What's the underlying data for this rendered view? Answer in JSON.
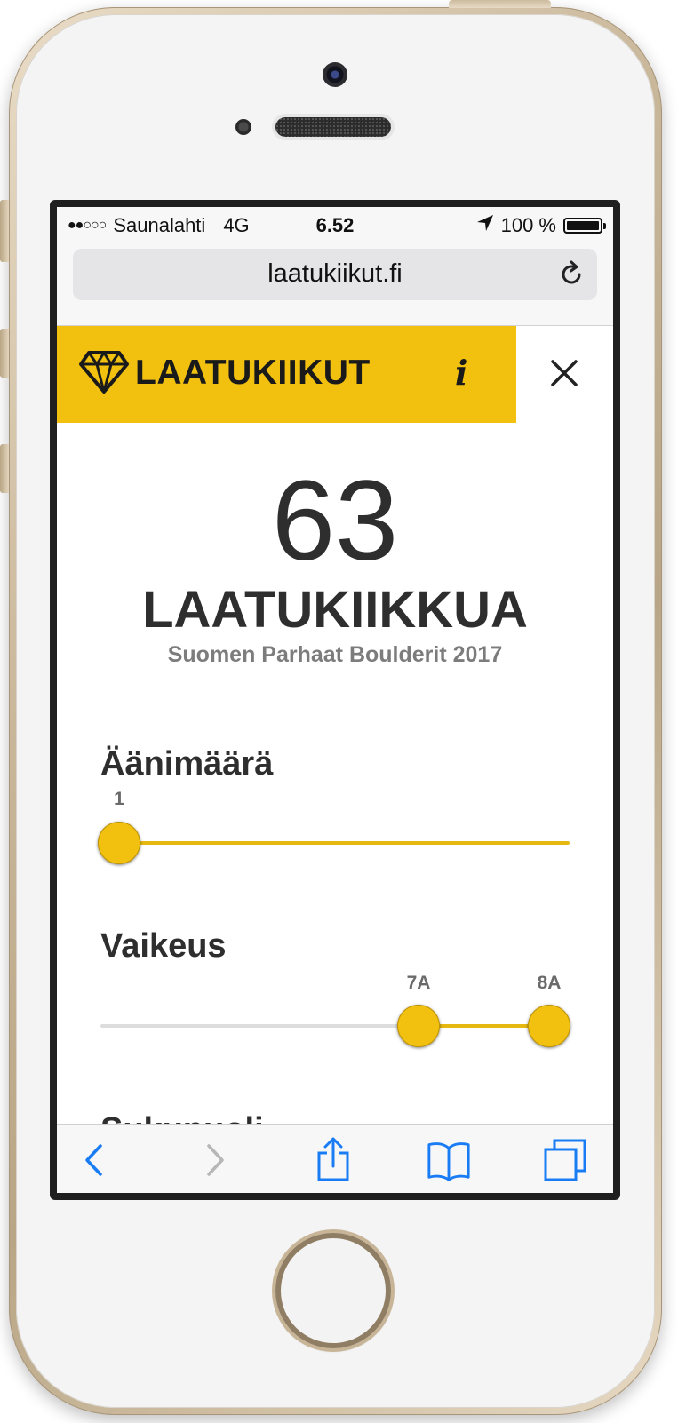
{
  "status_bar": {
    "signal": "●●○○○",
    "carrier": "Saunalahti",
    "network": "4G",
    "time": "6.52",
    "battery": "100 %",
    "battery_level": 1.0
  },
  "browser": {
    "url": "laatukiikut.fi",
    "reload_icon": "reload-icon"
  },
  "header": {
    "logo_icon": "diamond-icon",
    "brand": "LAATUKIIKUT",
    "info_label": "i",
    "close_icon": "close-icon",
    "accent_color": "#f2c110"
  },
  "hero": {
    "count": "63",
    "count_label": "LAATUKIIKKUA",
    "subtitle": "Suomen Parhaat Boulderit 2017"
  },
  "filters": {
    "votes": {
      "label": "Äänimäärä",
      "value_label": "1",
      "value": 1,
      "position": 0.0
    },
    "difficulty": {
      "label": "Vaikeus",
      "min_label": "7A",
      "max_label": "8A",
      "min_position": 0.69,
      "max_position": 1.0
    },
    "next_section_label": "Sukupuoli"
  },
  "toolbar": {
    "back_icon": "chevron-left-icon",
    "forward_icon": "chevron-right-icon",
    "share_icon": "share-icon",
    "bookmarks_icon": "book-icon",
    "tabs_icon": "tabs-icon",
    "active_color": "#1a7cf5",
    "disabled_color": "#b7b7b7"
  }
}
